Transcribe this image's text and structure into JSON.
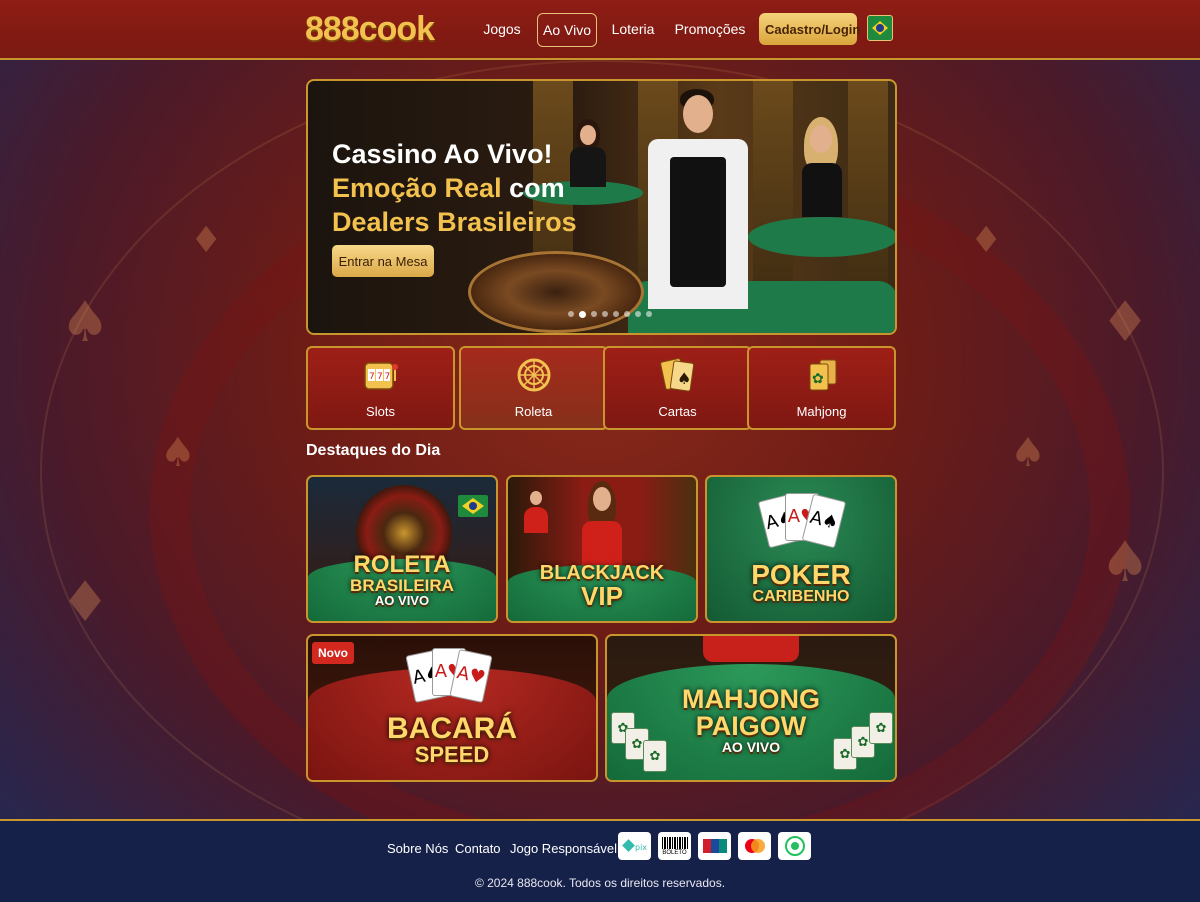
{
  "header": {
    "logo": "888cook",
    "nav": [
      "Jogos",
      "Ao Vivo",
      "Loteria",
      "Promoções"
    ],
    "active_nav": "Ao Vivo",
    "login_label": "Cadastro/Login",
    "language_flag": "brazil-flag-icon"
  },
  "hero": {
    "title_line1": "Cassino Ao Vivo!",
    "title_line2a": "Emoção Real",
    "title_line2b": "com",
    "title_line3": "Dealers Brasileiros",
    "cta_label": "Entrar na Mesa",
    "slide_count": 8,
    "active_slide": 2
  },
  "categories": [
    {
      "label": "Slots",
      "icon": "slot-machine-icon"
    },
    {
      "label": "Roleta",
      "icon": "roulette-wheel-icon"
    },
    {
      "label": "Cartas",
      "icon": "playing-cards-icon"
    },
    {
      "label": "Mahjong",
      "icon": "mahjong-tile-icon"
    }
  ],
  "highlights": {
    "title": "Destaques do Dia",
    "games": [
      {
        "line1": "ROLETA",
        "line2": "BRASILEIRA",
        "line3": "AO VIVO"
      },
      {
        "line1": "BLACKJACK",
        "line2": "VIP"
      },
      {
        "line1": "POKER",
        "line2": "CARIBENHO"
      },
      {
        "line1": "BACARÁ",
        "line2": "SPEED",
        "badge": "Novo"
      },
      {
        "line1": "MAHJONG",
        "line2": "PAIGOW",
        "line3": "AO VIVO"
      }
    ]
  },
  "footer": {
    "links": [
      "Sobre Nós",
      "Contato",
      "Jogo Responsável"
    ],
    "payments": [
      "pix-icon",
      "boleto-icon",
      "unionpay-icon",
      "mastercard-icon",
      "picpay-icon"
    ],
    "boleto_label": "BOLETO",
    "copyright": "© 2024 888cook. Todos os direitos reservados."
  },
  "colors": {
    "gold": "#f2c14e",
    "header_red": "#8e1d14",
    "footer_navy": "#16214a"
  }
}
